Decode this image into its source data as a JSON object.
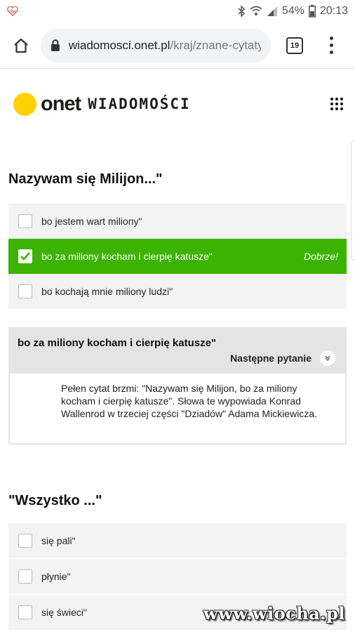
{
  "status_bar": {
    "battery": "54%",
    "time": "20:13"
  },
  "browser": {
    "url_domain": "wiadomosci.onet.pl",
    "url_path": "/kraj/znane-cytaty",
    "tab_count": "19"
  },
  "header": {
    "brand": "onet",
    "section": "WIADOMOŚCI"
  },
  "question1": {
    "title": "Nazywam się Milijon...\"",
    "options": [
      {
        "label": "bo jestem wart miliony\"",
        "state": "unchecked"
      },
      {
        "label": "bo za miliony kocham i cierpię katusze\"",
        "state": "correct"
      },
      {
        "label": "bo kochają mnie miliony ludzi\"",
        "state": "unchecked"
      }
    ],
    "result_label": "Dobrze!"
  },
  "answer": {
    "title": "bo za miliony kocham i cierpię katusze\"",
    "next_label": "Następne pytanie",
    "body": "Pełen cytat brzmi: \"Nazywam się Milijon, bo za miliony kocham i cierpię katusze\". Słowa te wypowiada Konrad Wallenrod w trzeciej części \"Dziadów\" Adama Mickiewicza."
  },
  "question2": {
    "title": "\"Wszystko ...\"",
    "options": [
      {
        "label": "się pali\""
      },
      {
        "label": "płynie\""
      },
      {
        "label": "się świeci\""
      }
    ]
  },
  "watermark": "www.wiocha.pl",
  "colors": {
    "correct": "#3bb300",
    "logo": "#fdd105"
  }
}
